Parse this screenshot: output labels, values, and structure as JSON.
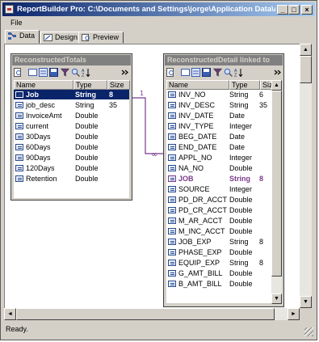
{
  "window": {
    "title": "ReportBuilder Pro: C:\\Documents and Settings\\jorge\\Application Data\\Ac...",
    "min_glyph": "_",
    "max_glyph": "□",
    "close_glyph": "×"
  },
  "menu": {
    "file_label": "File"
  },
  "tabs": [
    {
      "label": "Data"
    },
    {
      "label": "Design"
    },
    {
      "label": "Preview"
    }
  ],
  "status": {
    "text": "Ready."
  },
  "colors": {
    "link_line": "#7a3a8a",
    "selection": "#0a246a",
    "panel_title_bg": "#808080"
  },
  "totals_panel": {
    "title": "ReconstructedTotals",
    "columns": [
      "Name",
      "Type",
      "Size"
    ],
    "rows": [
      {
        "name": "Job",
        "type": "String",
        "size": "8",
        "selected": true
      },
      {
        "name": "job_desc",
        "type": "String",
        "size": "35"
      },
      {
        "name": "InvoiceAmt",
        "type": "Double",
        "size": ""
      },
      {
        "name": "current",
        "type": "Double",
        "size": ""
      },
      {
        "name": "30Days",
        "type": "Double",
        "size": ""
      },
      {
        "name": "60Days",
        "type": "Double",
        "size": ""
      },
      {
        "name": "90Days",
        "type": "Double",
        "size": ""
      },
      {
        "name": "120Days",
        "type": "Double",
        "size": ""
      },
      {
        "name": "Retention",
        "type": "Double",
        "size": ""
      }
    ]
  },
  "detail_panel": {
    "title": "ReconstructedDetail linked to",
    "columns": [
      "Name",
      "Type",
      "Siz"
    ],
    "rows": [
      {
        "name": "INV_NO",
        "type": "String",
        "size": "6"
      },
      {
        "name": "INV_DESC",
        "type": "String",
        "size": "35"
      },
      {
        "name": "INV_DATE",
        "type": "Date",
        "size": ""
      },
      {
        "name": "INV_TYPE",
        "type": "Integer",
        "size": ""
      },
      {
        "name": "BEG_DATE",
        "type": "Date",
        "size": ""
      },
      {
        "name": "END_DATE",
        "type": "Date",
        "size": ""
      },
      {
        "name": "APPL_NO",
        "type": "Integer",
        "size": ""
      },
      {
        "name": "NA_NO",
        "type": "Double",
        "size": ""
      },
      {
        "name": "JOB",
        "type": "String",
        "size": "8",
        "linked": true
      },
      {
        "name": "SOURCE",
        "type": "Integer",
        "size": ""
      },
      {
        "name": "PD_DR_ACCT",
        "type": "Double",
        "size": ""
      },
      {
        "name": "PD_CR_ACCT",
        "type": "Double",
        "size": ""
      },
      {
        "name": "M_AR_ACCT",
        "type": "Double",
        "size": ""
      },
      {
        "name": "M_INC_ACCT",
        "type": "Double",
        "size": ""
      },
      {
        "name": "JOB_EXP",
        "type": "String",
        "size": "8"
      },
      {
        "name": "PHASE_EXP",
        "type": "Double",
        "size": ""
      },
      {
        "name": "EQUIP_EXP",
        "type": "String",
        "size": "8"
      },
      {
        "name": "G_AMT_BILL",
        "type": "Double",
        "size": ""
      },
      {
        "name": "B_AMT_BILL",
        "type": "Double",
        "size": ""
      }
    ]
  },
  "link": {
    "one_label": "1",
    "many_label": "∞"
  }
}
